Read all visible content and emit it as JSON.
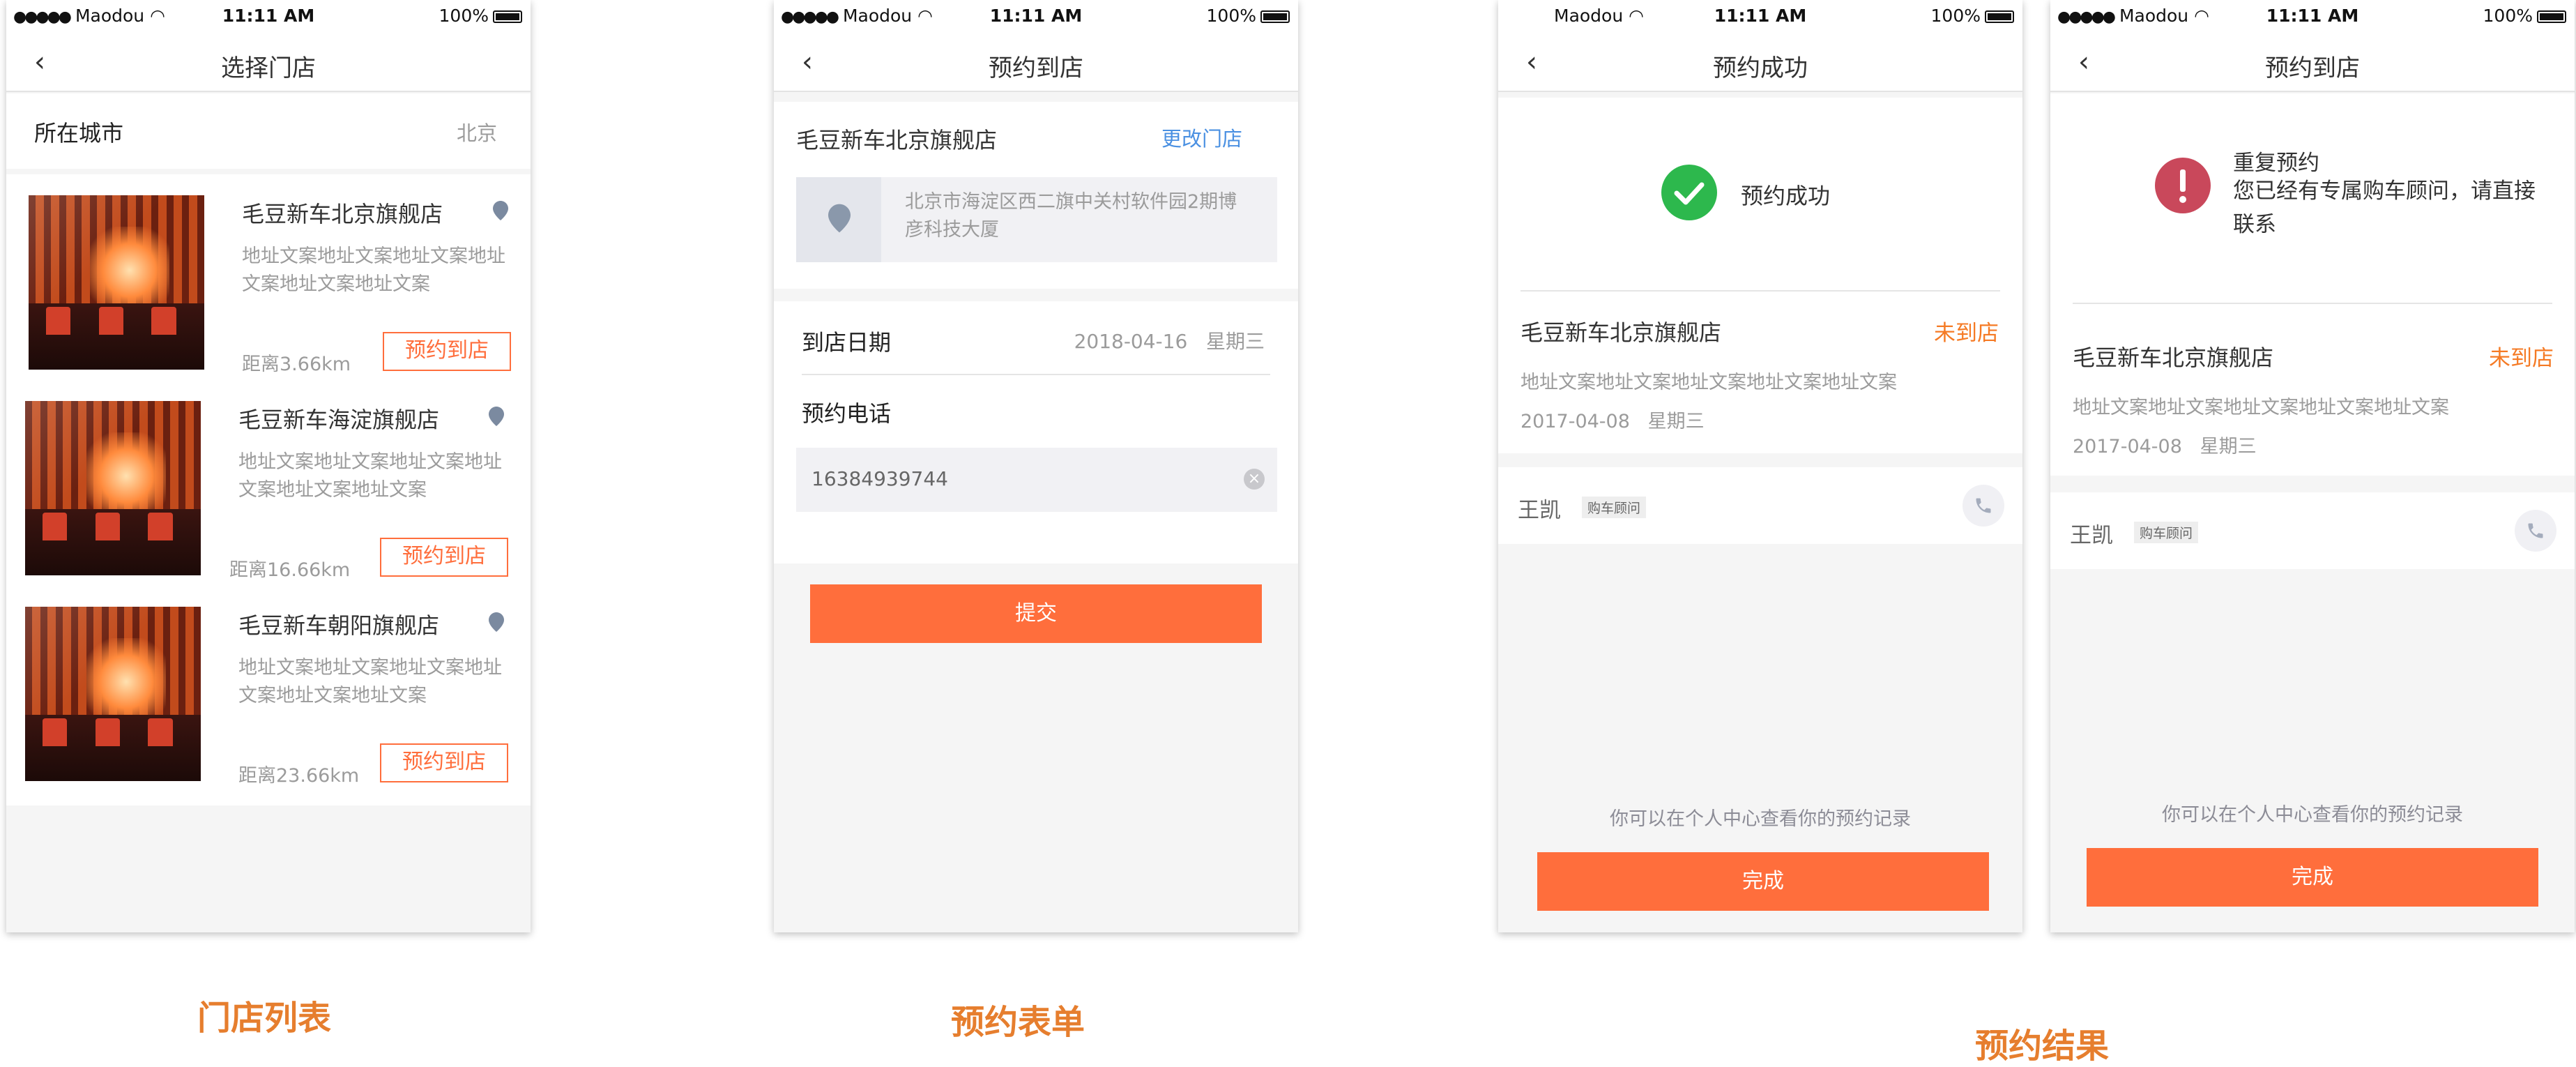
{
  "status_bar": {
    "carrier": "Maodou",
    "time": "11:11 AM",
    "battery": "100%"
  },
  "screen1": {
    "title": "选择门店",
    "city_label": "所在城市",
    "city_value": "北京",
    "stores": [
      {
        "name": "毛豆新车北京旗舰店",
        "address": "地址文案地址文案地址文案地址文案地址文案地址文案",
        "distance": "距离3.66km",
        "button": "预约到店"
      },
      {
        "name": "毛豆新车海淀旗舰店",
        "address": "地址文案地址文案地址文案地址文案地址文案地址文案",
        "distance": "距离16.66km",
        "button": "预约到店"
      },
      {
        "name": "毛豆新车朝阳旗舰店",
        "address": "地址文案地址文案地址文案地址文案地址文案地址文案",
        "distance": "距离23.66km",
        "button": "预约到店"
      }
    ]
  },
  "screen2": {
    "title": "预约到店",
    "store_name": "毛豆新车北京旗舰店",
    "change_store": "更改门店",
    "address": "北京市海淀区西二旗中关村软件园2期博彦科技大厦",
    "date_label": "到店日期",
    "date_value": "2018-04-16   星期三",
    "phone_label": "预约电话",
    "phone_value": "16384939744",
    "submit": "提交"
  },
  "screen3": {
    "title": "预约成功",
    "result": "预约成功",
    "store_name": "毛豆新车北京旗舰店",
    "status": "未到店",
    "address": "地址文案地址文案地址文案地址文案地址文案",
    "date": "2017-04-08   星期三",
    "advisor": "王凯",
    "advisor_tag": "购车顾问",
    "hint": "你可以在个人中心查看你的预约记录",
    "done": "完成"
  },
  "screen4": {
    "title": "预约到店",
    "warn_line1": "重复预约",
    "warn_line2": "您已经有专属购车顾问，请直接联系",
    "store_name": "毛豆新车北京旗舰店",
    "status": "未到店",
    "address": "地址文案地址文案地址文案地址文案地址文案",
    "date": "2017-04-08   星期三",
    "advisor": "王凯",
    "advisor_tag": "购车顾问",
    "hint": "你可以在个人中心查看你的预约记录",
    "done": "完成"
  },
  "captions": {
    "list": "门店列表",
    "form": "预约表单",
    "result": "预约结果"
  },
  "colors": {
    "accent": "#ff6e3c",
    "success": "#2db84d",
    "warning": "#c9485b",
    "link": "#4a90e2"
  }
}
